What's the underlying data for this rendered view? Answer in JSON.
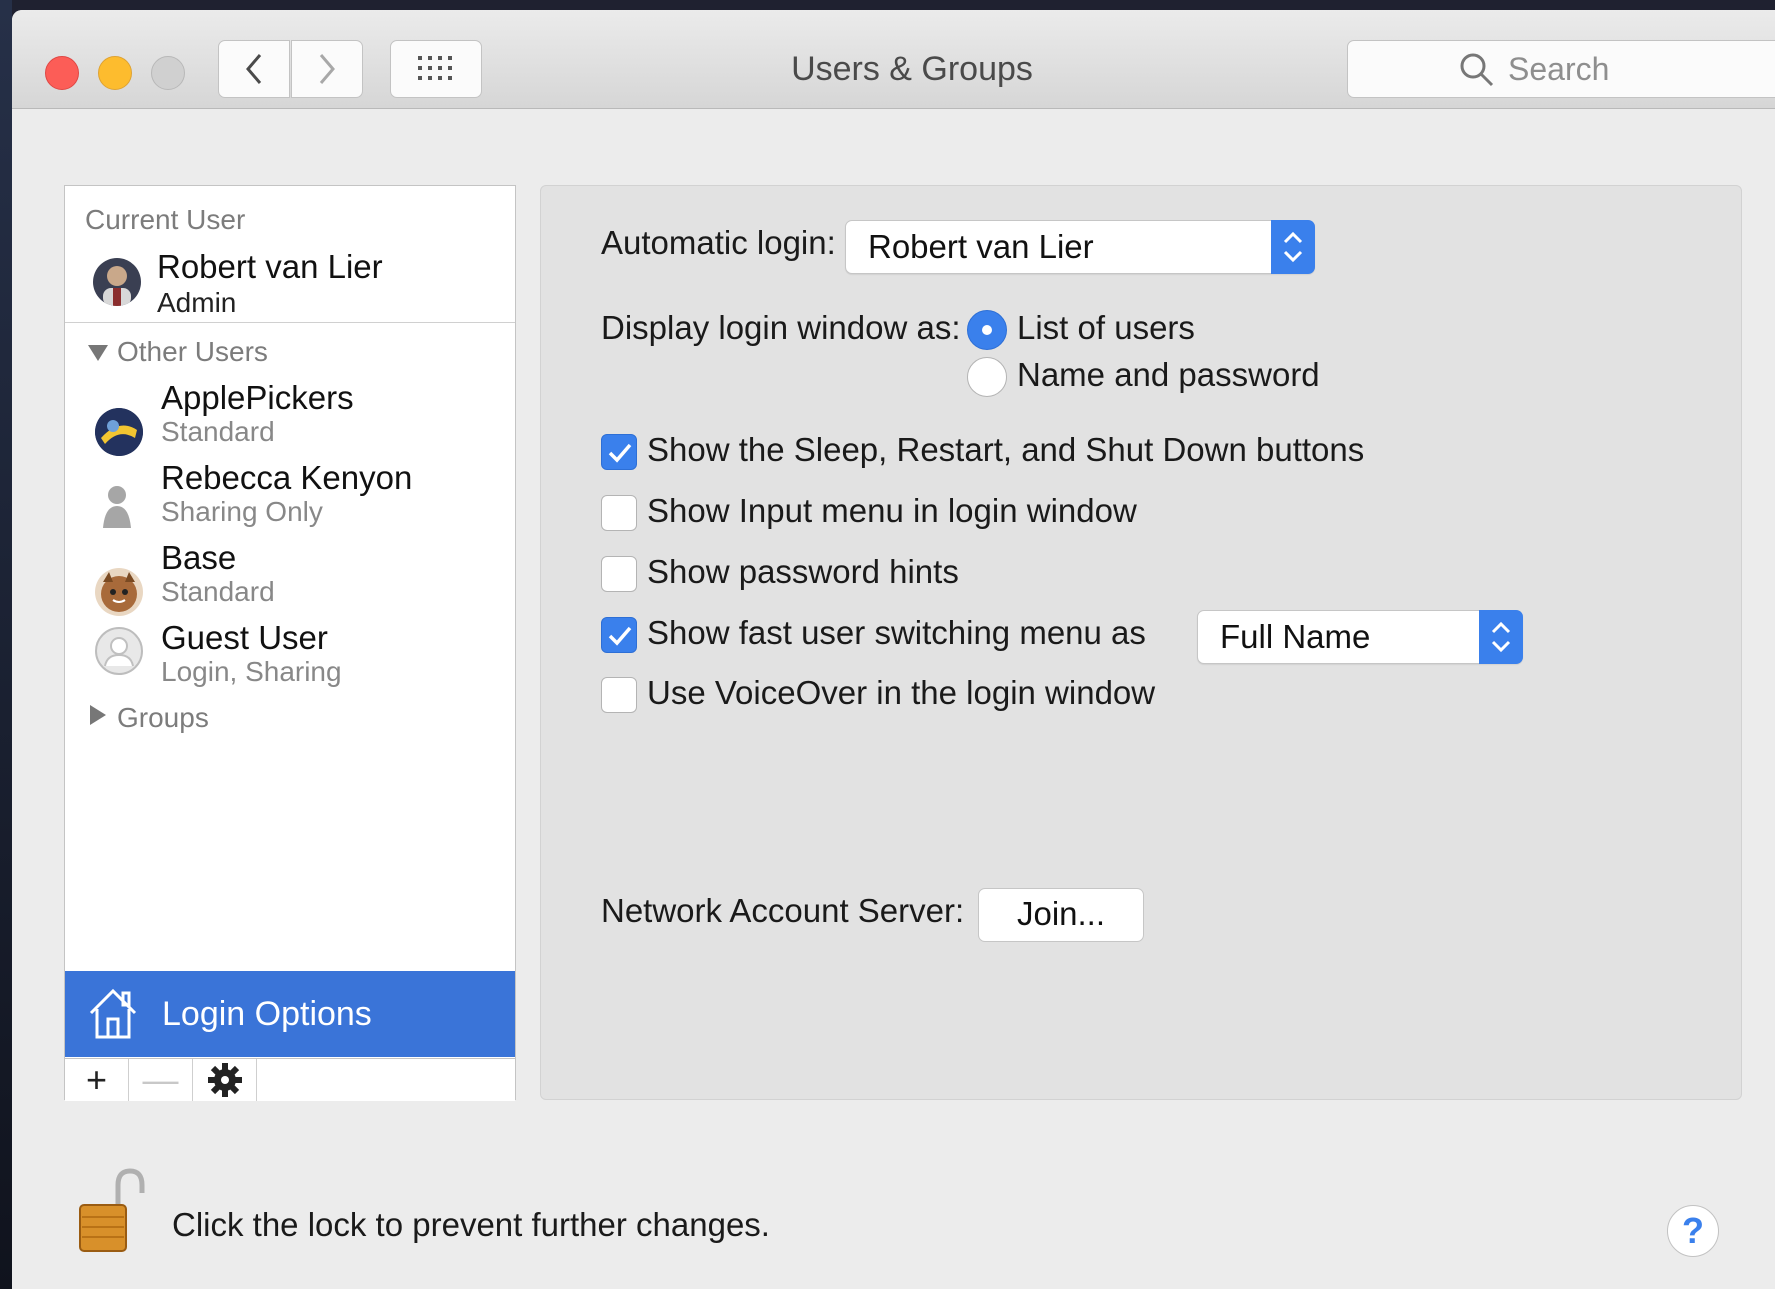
{
  "window": {
    "title": "Users & Groups",
    "search_placeholder": "Search"
  },
  "sidebar": {
    "current_user_header": "Current User",
    "current_user": {
      "name": "Robert van Lier",
      "role": "Admin"
    },
    "other_users_header": "Other Users",
    "other_users": [
      {
        "name": "ApplePickers",
        "role": "Standard"
      },
      {
        "name": "Rebecca Kenyon",
        "role": "Sharing Only"
      },
      {
        "name": "Base",
        "role": "Standard"
      },
      {
        "name": "Guest User",
        "role": "Login, Sharing"
      }
    ],
    "groups_header": "Groups",
    "login_options_label": "Login Options",
    "tools": {
      "add": "+",
      "remove": "—"
    }
  },
  "panel": {
    "automatic_login_label": "Automatic login:",
    "automatic_login_value": "Robert van Lier",
    "display_login_label": "Display login window as:",
    "radio_options": [
      {
        "label": "List of users",
        "selected": true
      },
      {
        "label": "Name and password",
        "selected": false
      }
    ],
    "checkboxes": [
      {
        "label": "Show the Sleep, Restart, and Shut Down buttons",
        "checked": true
      },
      {
        "label": "Show Input menu in login window",
        "checked": false
      },
      {
        "label": "Show password hints",
        "checked": false
      },
      {
        "label": "Show fast user switching menu as",
        "checked": true
      },
      {
        "label": "Use VoiceOver in the login window",
        "checked": false
      }
    ],
    "fast_switch_value": "Full Name",
    "network_server_label": "Network Account Server:",
    "join_button": "Join..."
  },
  "footer": {
    "lock_text": "Click the lock to prevent further changes.",
    "help": "?"
  },
  "colors": {
    "accent": "#3a80ec",
    "selection": "#3a74d8"
  }
}
